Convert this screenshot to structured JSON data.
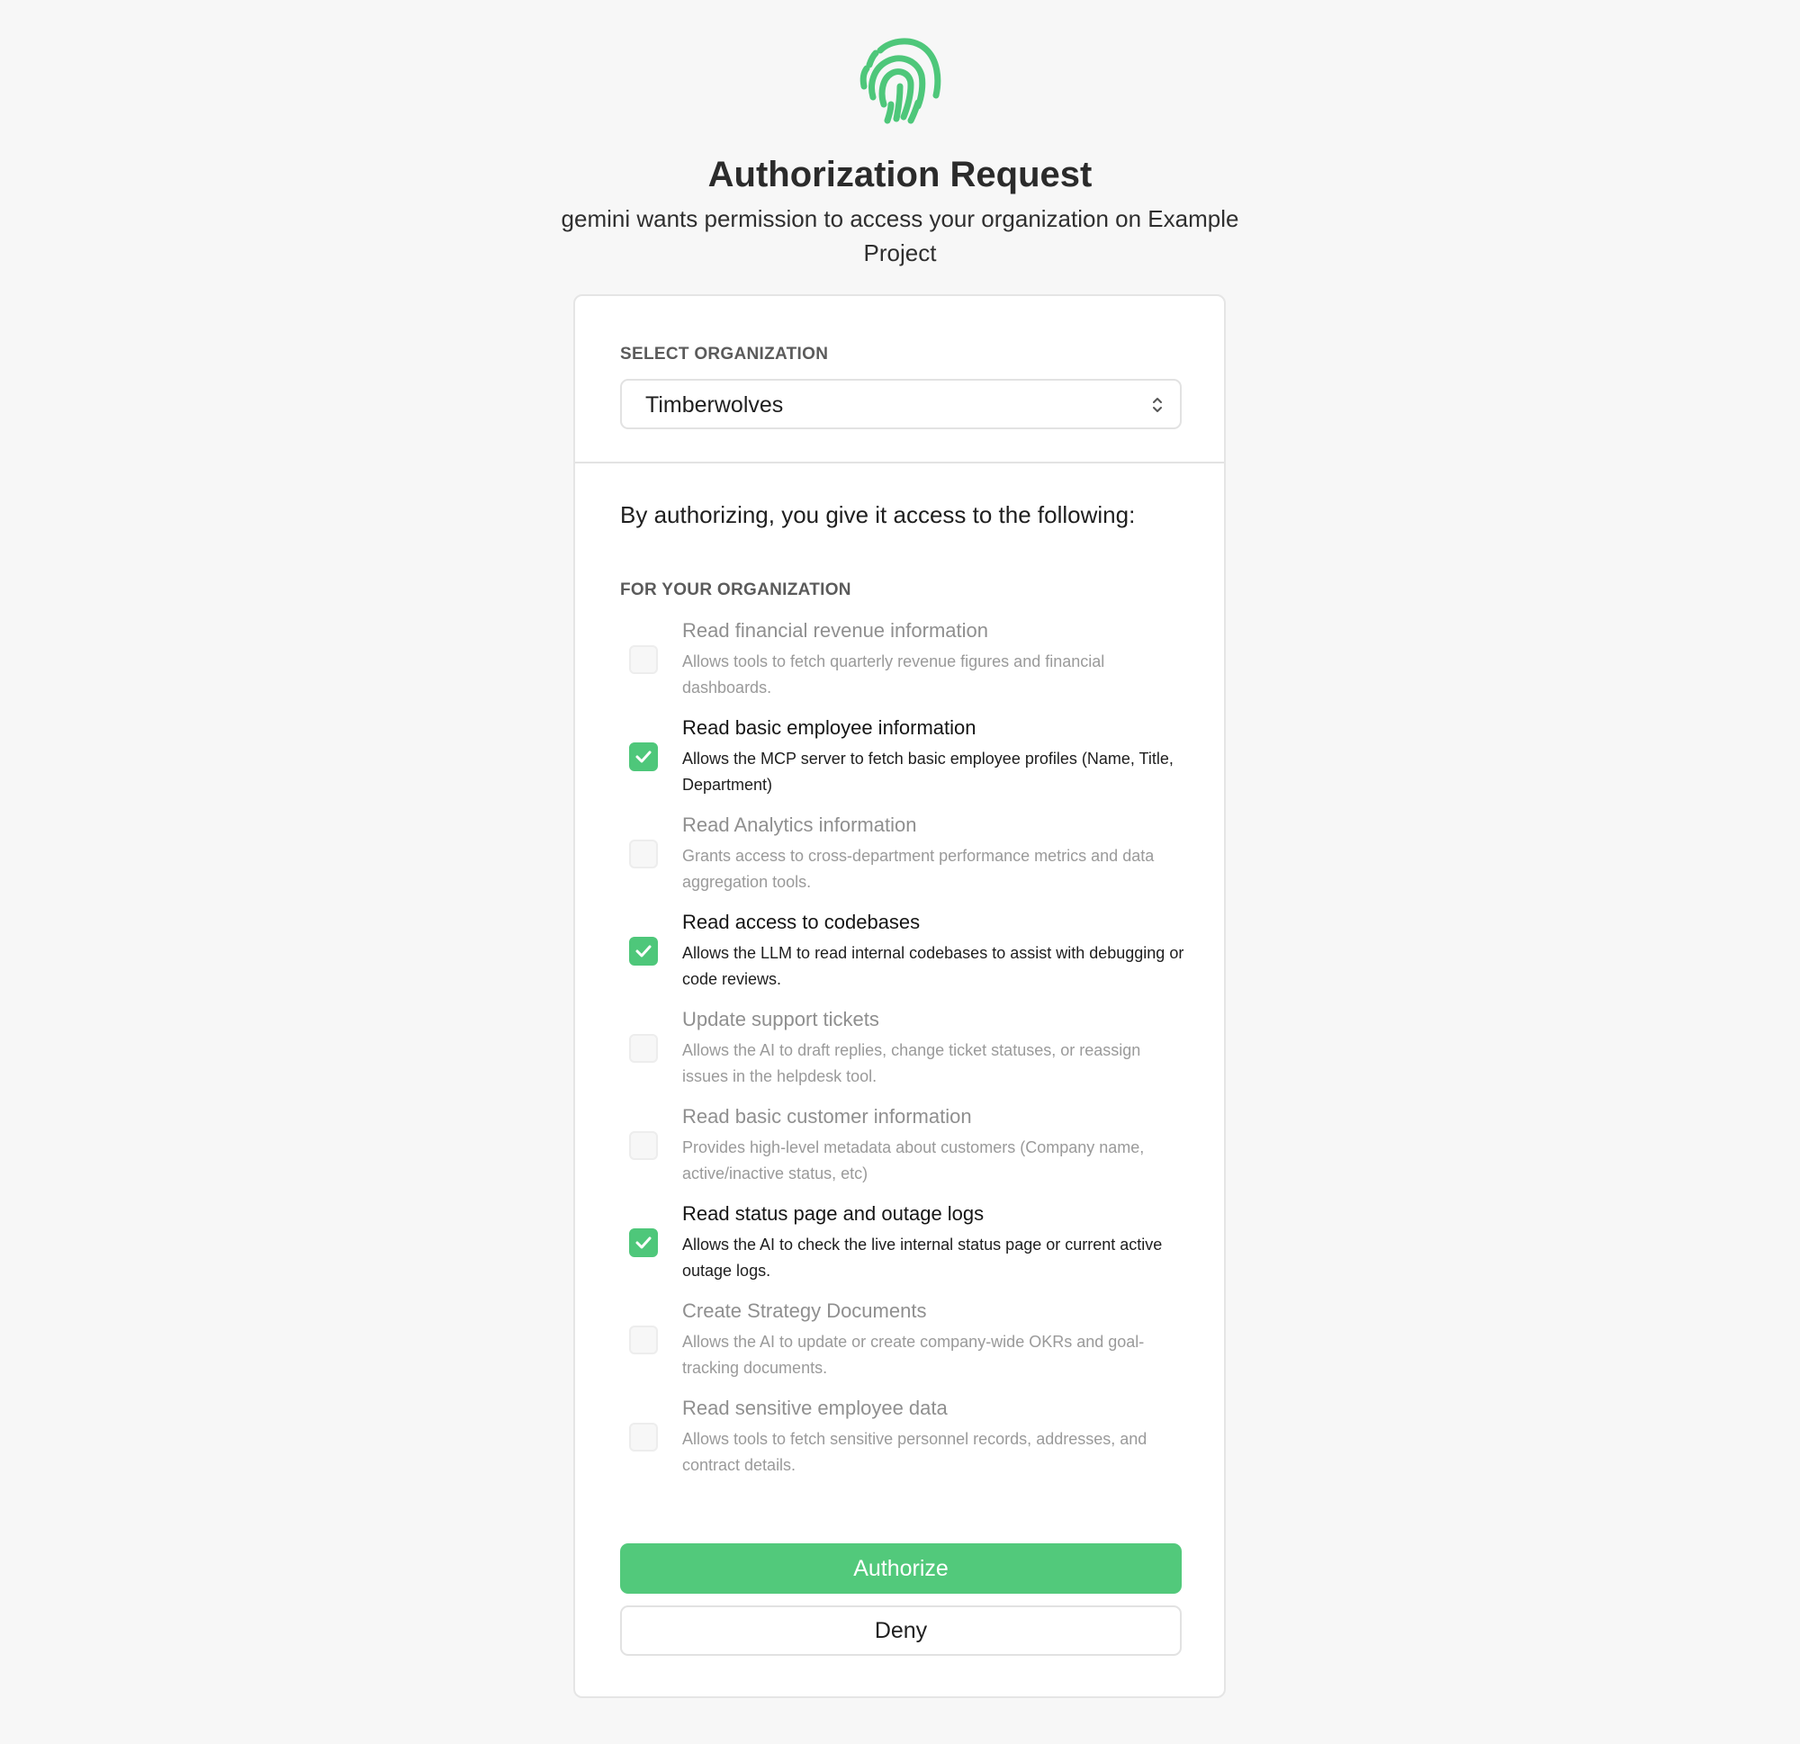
{
  "header": {
    "logo_icon": "fingerprint-icon",
    "title": "Authorization Request",
    "subtitle": "gemini wants permission to access your organization on Example Project"
  },
  "organization": {
    "label": "SELECT ORGANIZATION",
    "selected": "Timberwolves",
    "icon": "chevron-up-down-icon"
  },
  "intro": "By authorizing, you give it access to the following:",
  "section_label": "FOR YOUR ORGANIZATION",
  "permissions": [
    {
      "title": "Read financial revenue information",
      "description": "Allows tools to fetch quarterly revenue figures and financial dashboards.",
      "checked": false
    },
    {
      "title": "Read basic employee information",
      "description": "Allows the MCP server to fetch basic employee profiles (Name, Title, Department)",
      "checked": true
    },
    {
      "title": "Read Analytics information",
      "description": "Grants access to cross-department performance metrics and data aggregation tools.",
      "checked": false
    },
    {
      "title": "Read access to codebases",
      "description": "Allows the LLM to read internal codebases to assist with debugging or code reviews.",
      "checked": true
    },
    {
      "title": "Update support tickets",
      "description": "Allows the AI to draft replies, change ticket statuses, or reassign issues in the helpdesk tool.",
      "checked": false
    },
    {
      "title": "Read basic customer information",
      "description": "Provides high-level metadata about customers (Company name, active/inactive status, etc)",
      "checked": false
    },
    {
      "title": "Read status page and outage logs",
      "description": "Allows the AI to check the live internal status page or current active outage logs.",
      "checked": true
    },
    {
      "title": "Create Strategy Documents",
      "description": "Allows the AI to update or create company-wide OKRs and goal-tracking documents.",
      "checked": false
    },
    {
      "title": "Read sensitive employee data",
      "description": "Allows tools to fetch sensitive personnel records, addresses, and contract details.",
      "checked": false
    }
  ],
  "buttons": {
    "authorize": "Authorize",
    "deny": "Deny"
  },
  "colors": {
    "accent": "#52c97b",
    "background": "#f7f7f7",
    "card": "#ffffff"
  }
}
